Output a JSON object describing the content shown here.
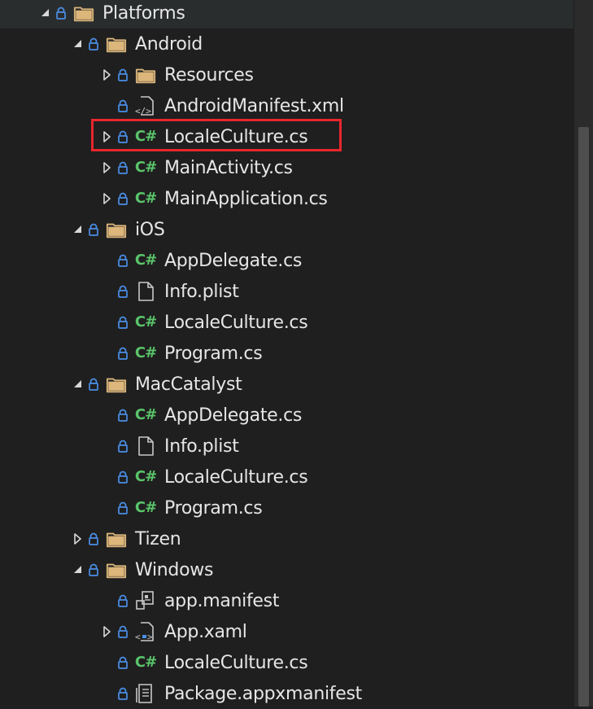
{
  "tree": {
    "items": [
      {
        "label": "Platforms",
        "type": "folder",
        "expander": "expanded",
        "indent": 0
      },
      {
        "label": "Android",
        "type": "folder",
        "expander": "expanded",
        "indent": 1
      },
      {
        "label": "Resources",
        "type": "folder",
        "expander": "collapsed",
        "indent": 2
      },
      {
        "label": "AndroidManifest.xml",
        "type": "xml",
        "expander": "none",
        "indent": 2
      },
      {
        "label": "LocaleCulture.cs",
        "type": "cs",
        "expander": "collapsed",
        "indent": 2,
        "highlighted": true
      },
      {
        "label": "MainActivity.cs",
        "type": "cs",
        "expander": "collapsed",
        "indent": 2
      },
      {
        "label": "MainApplication.cs",
        "type": "cs",
        "expander": "collapsed",
        "indent": 2
      },
      {
        "label": "iOS",
        "type": "folder",
        "expander": "expanded",
        "indent": 1
      },
      {
        "label": "AppDelegate.cs",
        "type": "cs",
        "expander": "none",
        "indent": 2
      },
      {
        "label": "Info.plist",
        "type": "file",
        "expander": "none",
        "indent": 2
      },
      {
        "label": "LocaleCulture.cs",
        "type": "cs",
        "expander": "none",
        "indent": 2
      },
      {
        "label": "Program.cs",
        "type": "cs",
        "expander": "none",
        "indent": 2
      },
      {
        "label": "MacCatalyst",
        "type": "folder",
        "expander": "expanded",
        "indent": 1
      },
      {
        "label": "AppDelegate.cs",
        "type": "cs",
        "expander": "none",
        "indent": 2
      },
      {
        "label": "Info.plist",
        "type": "file",
        "expander": "none",
        "indent": 2
      },
      {
        "label": "LocaleCulture.cs",
        "type": "cs",
        "expander": "none",
        "indent": 2
      },
      {
        "label": "Program.cs",
        "type": "cs",
        "expander": "none",
        "indent": 2
      },
      {
        "label": "Tizen",
        "type": "folder",
        "expander": "collapsed",
        "indent": 1
      },
      {
        "label": "Windows",
        "type": "folder",
        "expander": "expanded",
        "indent": 1
      },
      {
        "label": "app.manifest",
        "type": "manifest",
        "expander": "none",
        "indent": 2
      },
      {
        "label": "App.xaml",
        "type": "xaml",
        "expander": "collapsed",
        "indent": 2
      },
      {
        "label": "LocaleCulture.cs",
        "type": "cs",
        "expander": "none",
        "indent": 2
      },
      {
        "label": "Package.appxmanifest",
        "type": "appxmanifest",
        "expander": "none",
        "indent": 2
      }
    ]
  },
  "icons": {
    "csharp_text": "C#",
    "expanded": "expanded-arrow-icon",
    "collapsed": "collapsed-arrow-icon",
    "lock": "lock-icon"
  },
  "colors": {
    "background": "#1f1f1f",
    "text": "#e6e6e6",
    "lock": "#4a8fe7",
    "csharp": "#5ac46a",
    "folder": "#dcb67a",
    "highlight": "#e8262d"
  }
}
